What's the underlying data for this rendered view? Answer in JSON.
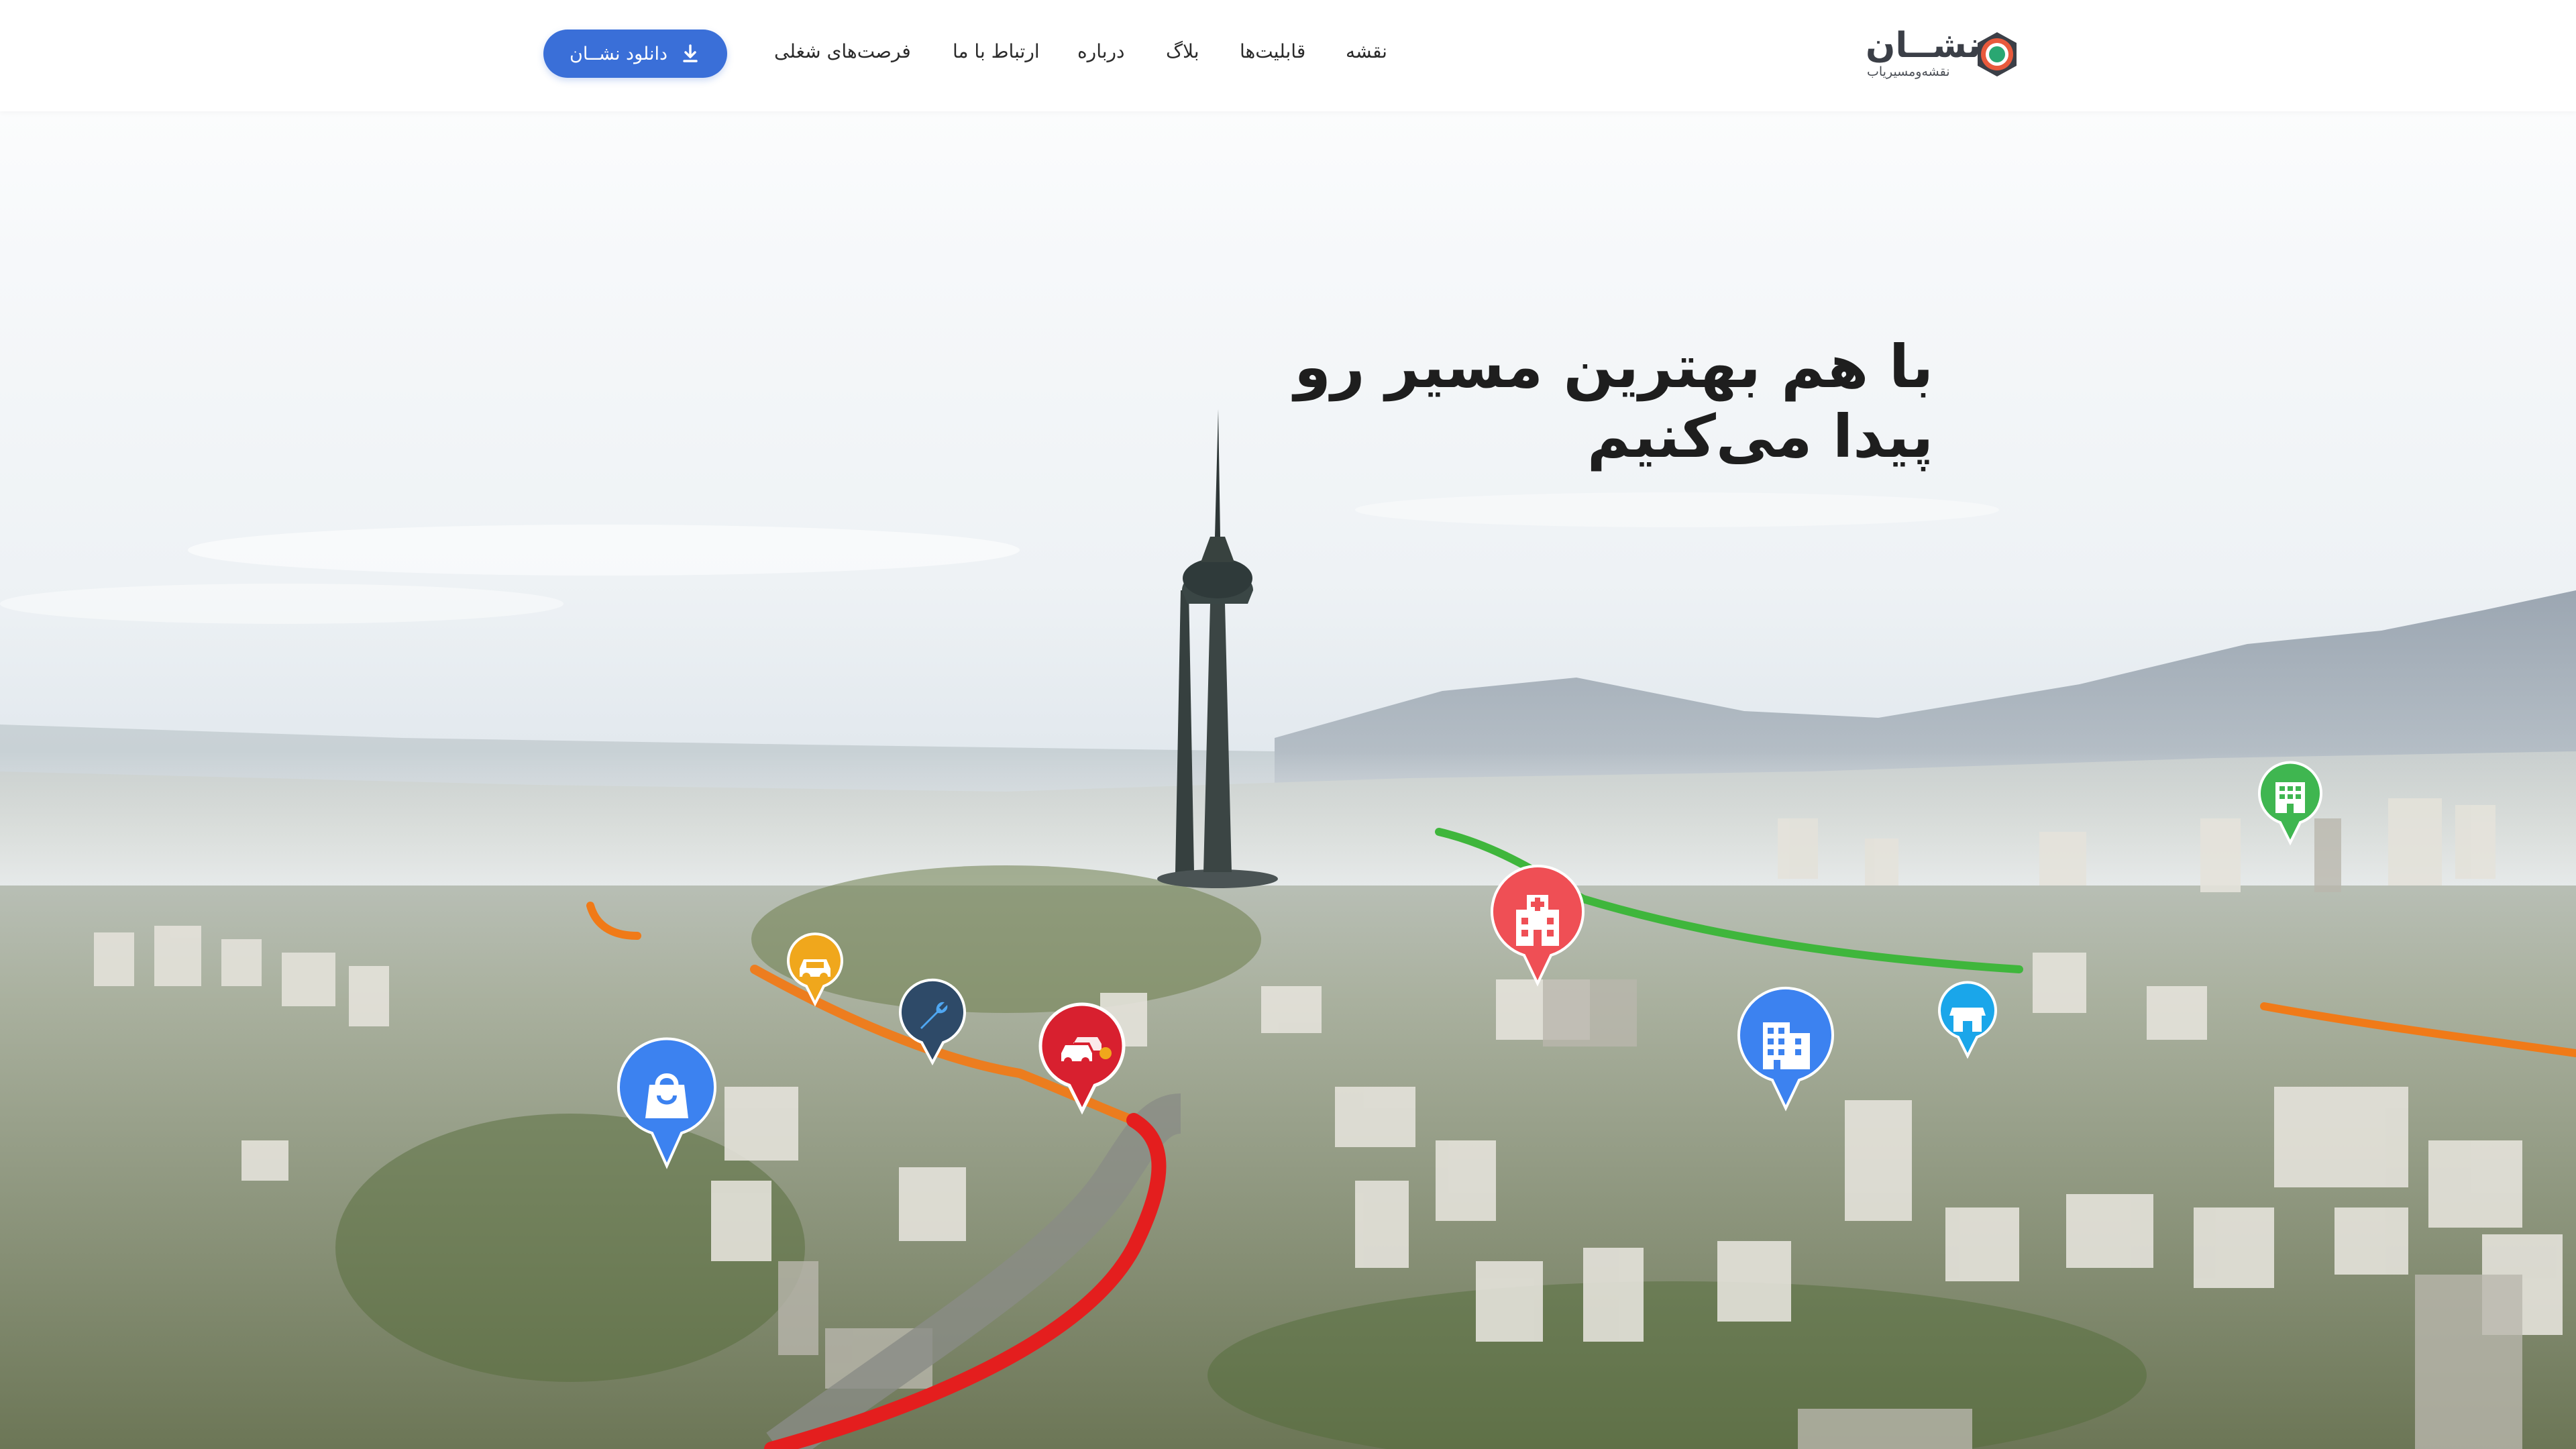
{
  "header": {
    "logo": {
      "wordmark": "نشــان",
      "tagline": "نقشه‌ومسیریاب",
      "colors": {
        "ring": "#3b3f47",
        "outer": "#e85a3c",
        "inner": "#2aa772"
      }
    },
    "nav_items": [
      {
        "label": "نقشه"
      },
      {
        "label": "قابلیت‌ها"
      },
      {
        "label": "بلاگ"
      },
      {
        "label": "درباره"
      },
      {
        "label": "ارتباط با ما"
      },
      {
        "label": "فرصت‌های شغلی"
      }
    ],
    "download_button": {
      "label": "دانلود نشــان",
      "icon": "download-icon",
      "color": "#3a6fd8"
    }
  },
  "hero": {
    "headline_line1": "با هم بهترین مسیر رو",
    "headline_line2": "پیدا می‌کنیم",
    "background": "aerial view of Tehran city with Milad Tower and mountains",
    "route_colors": {
      "heavy": "#e41e1e",
      "medium": "#f07a18",
      "light": "#3fb63c"
    },
    "pins": [
      {
        "icon": "shopping-bag-icon",
        "color": "#3c82f0"
      },
      {
        "icon": "car-icon",
        "color": "#f0a71c"
      },
      {
        "icon": "wrench-icon",
        "color": "#2e4a68"
      },
      {
        "icon": "traffic-cars-icon",
        "color": "#d8202f"
      },
      {
        "icon": "hospital-icon",
        "color": "#ef4f55"
      },
      {
        "icon": "office-building-icon",
        "color": "#3c82f0"
      },
      {
        "icon": "store-icon",
        "color": "#1aa6ea"
      },
      {
        "icon": "apartment-building-icon",
        "color": "#3fb650"
      }
    ]
  }
}
